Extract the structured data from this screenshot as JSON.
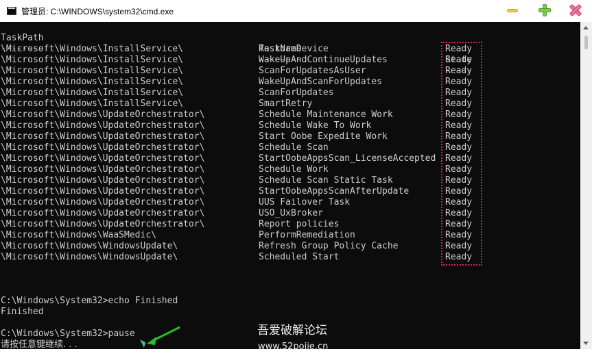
{
  "window": {
    "title": "管理员: C:\\WINDOWS\\system32\\cmd.exe"
  },
  "table": {
    "headers": [
      "TaskPath",
      "TaskName",
      "State"
    ],
    "separators": [
      "--------",
      "--------",
      "-----"
    ],
    "rows": [
      [
        "\\Microsoft\\Windows\\InstallService\\",
        "RestoreDevice",
        "Ready"
      ],
      [
        "\\Microsoft\\Windows\\InstallService\\",
        "WakeUpAndContinueUpdates",
        "Ready"
      ],
      [
        "\\Microsoft\\Windows\\InstallService\\",
        "ScanForUpdatesAsUser",
        "Ready"
      ],
      [
        "\\Microsoft\\Windows\\InstallService\\",
        "WakeUpAndScanForUpdates",
        "Ready"
      ],
      [
        "\\Microsoft\\Windows\\InstallService\\",
        "ScanForUpdates",
        "Ready"
      ],
      [
        "\\Microsoft\\Windows\\InstallService\\",
        "SmartRetry",
        "Ready"
      ],
      [
        "\\Microsoft\\Windows\\UpdateOrchestrator\\",
        "Schedule Maintenance Work",
        "Ready"
      ],
      [
        "\\Microsoft\\Windows\\UpdateOrchestrator\\",
        "Schedule Wake To Work",
        "Ready"
      ],
      [
        "\\Microsoft\\Windows\\UpdateOrchestrator\\",
        "Start Oobe Expedite Work",
        "Ready"
      ],
      [
        "\\Microsoft\\Windows\\UpdateOrchestrator\\",
        "Schedule Scan",
        "Ready"
      ],
      [
        "\\Microsoft\\Windows\\UpdateOrchestrator\\",
        "StartOobeAppsScan_LicenseAccepted",
        "Ready"
      ],
      [
        "\\Microsoft\\Windows\\UpdateOrchestrator\\",
        "Schedule Work",
        "Ready"
      ],
      [
        "\\Microsoft\\Windows\\UpdateOrchestrator\\",
        "Schedule Scan Static Task",
        "Ready"
      ],
      [
        "\\Microsoft\\Windows\\UpdateOrchestrator\\",
        "StartOobeAppsScanAfterUpdate",
        "Ready"
      ],
      [
        "\\Microsoft\\Windows\\UpdateOrchestrator\\",
        "UUS Failover Task",
        "Ready"
      ],
      [
        "\\Microsoft\\Windows\\UpdateOrchestrator\\",
        "USO_UxBroker",
        "Ready"
      ],
      [
        "\\Microsoft\\Windows\\UpdateOrchestrator\\",
        "Report policies",
        "Ready"
      ],
      [
        "\\Microsoft\\Windows\\WaaSMedic\\",
        "PerformRemediation",
        "Ready"
      ],
      [
        "\\Microsoft\\Windows\\WindowsUpdate\\",
        "Refresh Group Policy Cache",
        "Ready"
      ],
      [
        "\\Microsoft\\Windows\\WindowsUpdate\\",
        "Scheduled Start",
        "Ready"
      ]
    ]
  },
  "tail": {
    "echo_cmd": "C:\\Windows\\System32>echo Finished",
    "echo_out": "Finished",
    "pause_cmd": "C:\\Windows\\System32>pause",
    "pause_prompt": "请按任意键继续. . ."
  },
  "watermark": {
    "site_name": "吾爱破解论坛",
    "url": "www.52pojie.cn"
  },
  "colors": {
    "console_bg": "#0c0c0c",
    "console_text": "#cccccc",
    "highlight_box": "#e0186a",
    "arrow": "#22c422"
  },
  "icons": {
    "app": "cmd-icon",
    "minimize": "minimize-icon",
    "maximize": "maximize-icon",
    "close": "close-icon",
    "annotation": "arrow-icon"
  }
}
